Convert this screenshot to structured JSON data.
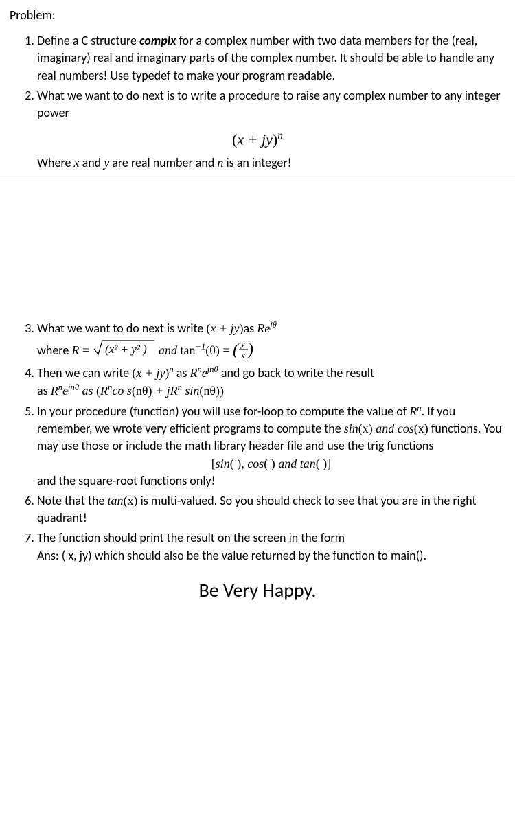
{
  "heading": "Problem:",
  "item1": "Define a C structure complx for a complex number with two data members for the (real, imaginary) real and imaginary parts of the complex number. It should be able to handle any real numbers! Use typedef to make your program readable.",
  "item1_emph": "complx",
  "item1_pre": "Define a C structure ",
  "item1_post": " for a complex number with two data members for the (real, imaginary) real and imaginary parts of the complex number. It should be able to handle any real numbers! Use typedef to make your program readable.",
  "item2": "What we want to do next is to write a procedure to raise any complex number to any integer power",
  "formula_main": "(x + jy)ⁿ",
  "formula_x": "x",
  "formula_plus": " + ",
  "formula_jy": "jy",
  "formula_n": "n",
  "after_formula_pre": "Where ",
  "after_formula_x": "x",
  "after_formula_and1": " and ",
  "after_formula_y": "y",
  "after_formula_mid": " are real number and ",
  "after_formula_n": "n",
  "after_formula_post": " is an integer!",
  "item3_pre": "What we want to do next is write ",
  "item3_expr1_open": "(",
  "item3_expr1_x": "x",
  "item3_expr1_plus": " + ",
  "item3_expr1_jy": "jy",
  "item3_expr1_close": ")",
  "item3_as": "as ",
  "item3_Re": "Re",
  "item3_jtheta": "jθ",
  "item3b_where": "where   ",
  "item3b_R": "R",
  "item3b_eq": " = ",
  "item3b_sqrt_open": "√(",
  "item3b_x2": "x²",
  "item3b_plus": " + ",
  "item3b_y2": "y²",
  "item3b_sqrt_close": " )",
  "item3b_and": "  and ",
  "item3b_tan": "tan",
  "item3b_inv": "−1",
  "item3b_theta": "(θ)",
  "item3b_eq2": " = ",
  "item3b_frac_y": "y",
  "item3b_frac_x": "x",
  "item4_pre": "Then we can write ",
  "item4_expr_open": "(",
  "item4_x": "x",
  "item4_plus": " + ",
  "item4_jy": "jy",
  "item4_close": ")",
  "item4_n": "n",
  "item4_as": " as ",
  "item4_Rn": "R",
  "item4_e": "e",
  "item4_jntheta": "jnθ",
  "item4_post": " and go back to write the result",
  "item4b_as": "as   ",
  "item4b_Rn": "R",
  "item4b_n": "n",
  "item4b_e": "e",
  "item4b_jntheta": "jnθ",
  "item4b_as2": "  as  ",
  "item4b_open": "(",
  "item4b_R": "R",
  "item4b_cos": "co s",
  "item4b_ntheta": "(nθ)",
  "item4b_plus": " + ",
  "item4b_jR": "jR",
  "item4b_sin": " sin",
  "item4b_ntheta2": "(nθ)",
  "item4b_close": ")",
  "item5_pre": "In your procedure (function) you will use for-loop to compute the value of ",
  "item5_Rn": "R",
  "item5_n": "n",
  "item5_mid1": ". If you remember, we wrote very efficient programs to compute the  ",
  "item5_sinx": "sin",
  "item5_x1": "(x)",
  "item5_and": " and ",
  "item5_cosx": "cos",
  "item5_x2": "(x)",
  "item5_mid2": " functions. You may use those or include the math library header file and use the trig functions",
  "item5_bracket_open": "[",
  "item5_sin": "sin",
  "item5_p1": "(   ), ",
  "item5_cos": "cos",
  "item5_p2": "(   ) ",
  "item5_and2": "and ",
  "item5_tan": "tan",
  "item5_p3": "(   )",
  "item5_bracket_close": "]",
  "item5_post": "and the square-root functions only!",
  "item6_pre": "Note that the ",
  "item6_tanx": "tan",
  "item6_x": "(x)",
  "item6_post": " is multi-valued. So you should check to see that you are in the right quadrant!",
  "item7": "The function should print the result on the screen in the form",
  "item7b": "Ans: ( x, jy) which should also be the value returned by the function to main().",
  "footer": "Be Very Happy."
}
